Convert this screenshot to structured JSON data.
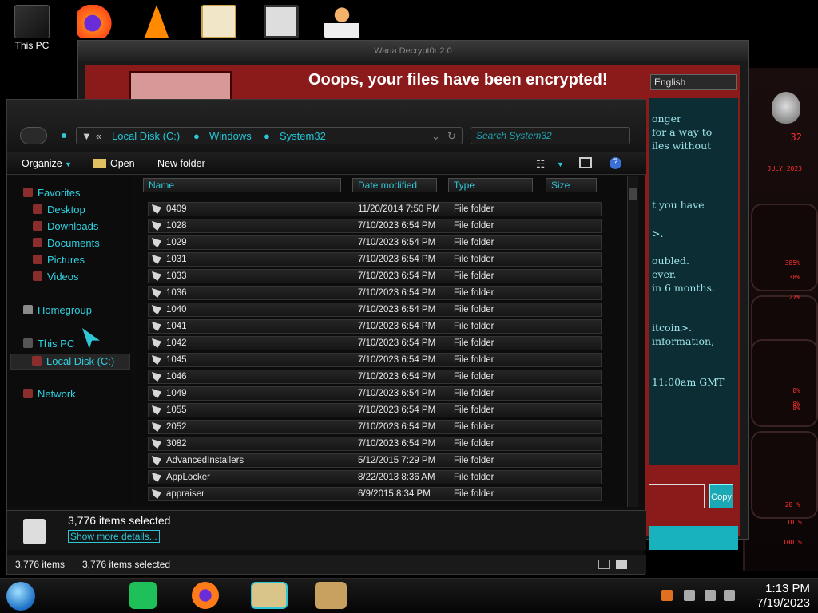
{
  "desktop": {
    "icons": [
      {
        "label": "This PC"
      },
      {
        "label": ""
      },
      {
        "label": ""
      },
      {
        "label": ""
      },
      {
        "label": ""
      },
      {
        "label": ""
      }
    ]
  },
  "wannacry": {
    "title": "Wana Decrypt0r 2.0",
    "headline": "Ooops, your files have been encrypted!",
    "language": "English",
    "text_lines": [
      "onger",
      "for a way to",
      "iles without",
      "",
      "t you have",
      "",
      ">.",
      "",
      "oubled.",
      "ever.",
      "in 6 months.",
      "",
      "itcoin>.",
      "information,",
      "",
      "11:00am GMT"
    ],
    "copy_label": "Copy"
  },
  "explorer": {
    "address": {
      "prefix": "«",
      "parts": [
        "Local Disk (C:)",
        "Windows",
        "System32"
      ]
    },
    "search_placeholder": "Search System32",
    "toolbar": {
      "organize": "Organize",
      "open": "Open",
      "new_folder": "New folder"
    },
    "nav": {
      "favorites": "Favorites",
      "desktop": "Desktop",
      "downloads": "Downloads",
      "documents": "Documents",
      "pictures": "Pictures",
      "videos": "Videos",
      "homegroup": "Homegroup",
      "this_pc": "This PC",
      "local_disk": "Local Disk (C:)",
      "network": "Network"
    },
    "columns": {
      "name": "Name",
      "date": "Date modified",
      "type": "Type",
      "size": "Size"
    },
    "rows": [
      {
        "name": "0409",
        "date": "11/20/2014 7:50 PM",
        "type": "File folder"
      },
      {
        "name": "1028",
        "date": "7/10/2023 6:54 PM",
        "type": "File folder"
      },
      {
        "name": "1029",
        "date": "7/10/2023 6:54 PM",
        "type": "File folder"
      },
      {
        "name": "1031",
        "date": "7/10/2023 6:54 PM",
        "type": "File folder"
      },
      {
        "name": "1033",
        "date": "7/10/2023 6:54 PM",
        "type": "File folder"
      },
      {
        "name": "1036",
        "date": "7/10/2023 6:54 PM",
        "type": "File folder"
      },
      {
        "name": "1040",
        "date": "7/10/2023 6:54 PM",
        "type": "File folder"
      },
      {
        "name": "1041",
        "date": "7/10/2023 6:54 PM",
        "type": "File folder"
      },
      {
        "name": "1042",
        "date": "7/10/2023 6:54 PM",
        "type": "File folder"
      },
      {
        "name": "1045",
        "date": "7/10/2023 6:54 PM",
        "type": "File folder"
      },
      {
        "name": "1046",
        "date": "7/10/2023 6:54 PM",
        "type": "File folder"
      },
      {
        "name": "1049",
        "date": "7/10/2023 6:54 PM",
        "type": "File folder"
      },
      {
        "name": "1055",
        "date": "7/10/2023 6:54 PM",
        "type": "File folder"
      },
      {
        "name": "2052",
        "date": "7/10/2023 6:54 PM",
        "type": "File folder"
      },
      {
        "name": "3082",
        "date": "7/10/2023 6:54 PM",
        "type": "File folder"
      },
      {
        "name": "AdvancedInstallers",
        "date": "5/12/2015 7:29 PM",
        "type": "File folder"
      },
      {
        "name": "AppLocker",
        "date": "8/22/2013 8:36 AM",
        "type": "File folder"
      },
      {
        "name": "appraiser",
        "date": "6/9/2015 8:34 PM",
        "type": "File folder"
      }
    ],
    "details": {
      "selected": "3,776 items selected",
      "show_more": "Show more details..."
    },
    "status": {
      "count": "3,776 items",
      "selected": "3,776 items selected"
    }
  },
  "widget": {
    "labels": [
      "32",
      "JULY 2023",
      "385%",
      "38%",
      "27%",
      "8%",
      "8%",
      "8%",
      "28 %",
      "10 %",
      "100 %"
    ]
  },
  "taskbar": {
    "time": "1:13 PM",
    "date": "7/19/2023"
  }
}
